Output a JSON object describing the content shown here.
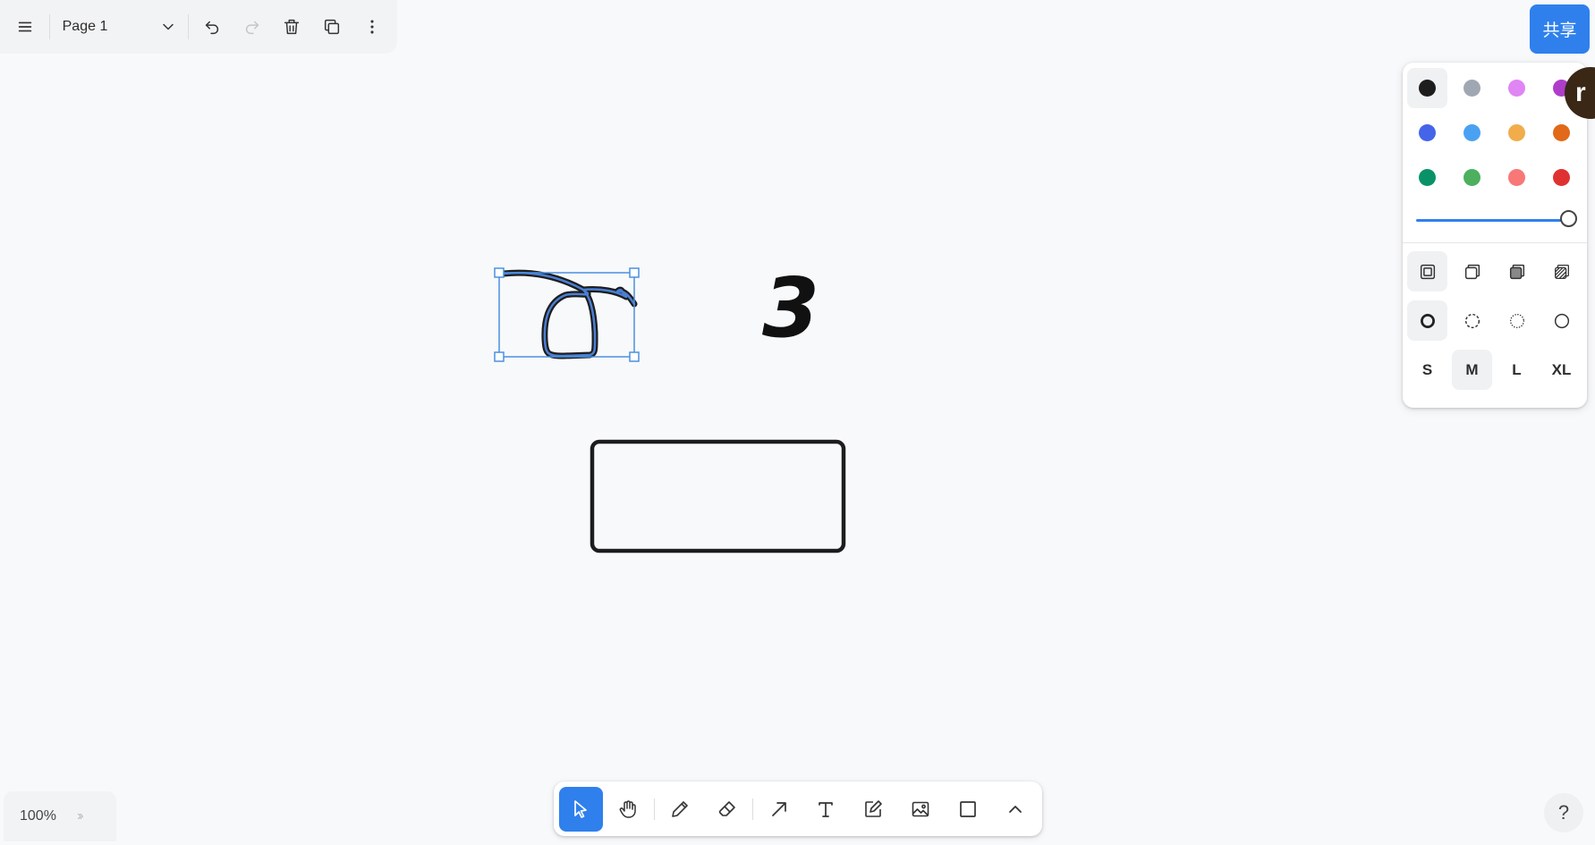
{
  "menu": {
    "page_name": "Page 1",
    "icons": [
      "menu-icon",
      "chevron-down-icon",
      "undo-icon",
      "redo-icon",
      "trash-icon",
      "duplicate-icon",
      "more-icon"
    ]
  },
  "share": {
    "label": "共享"
  },
  "avatar": {
    "initial": "r",
    "color": "#3a2716"
  },
  "style_panel": {
    "colors": [
      {
        "name": "black",
        "hex": "#1d1d1d",
        "selected": true
      },
      {
        "name": "grey",
        "hex": "#9fa8b2",
        "selected": false
      },
      {
        "name": "light-violet",
        "hex": "#e085f4",
        "selected": false
      },
      {
        "name": "violet",
        "hex": "#ae3ec9",
        "selected": false
      },
      {
        "name": "blue",
        "hex": "#4465e9",
        "selected": false
      },
      {
        "name": "light-blue",
        "hex": "#4ba1f1",
        "selected": false
      },
      {
        "name": "yellow",
        "hex": "#f1ac4b",
        "selected": false
      },
      {
        "name": "orange",
        "hex": "#e16919",
        "selected": false
      },
      {
        "name": "green",
        "hex": "#099268",
        "selected": false
      },
      {
        "name": "light-green",
        "hex": "#4cb05e",
        "selected": false
      },
      {
        "name": "light-red",
        "hex": "#f87777",
        "selected": false
      },
      {
        "name": "red",
        "hex": "#e03131",
        "selected": false
      }
    ],
    "opacity": 1,
    "fill_options": [
      {
        "name": "fill-none-icon",
        "selected": true
      },
      {
        "name": "fill-semi-icon",
        "selected": false
      },
      {
        "name": "fill-solid-icon",
        "selected": false
      },
      {
        "name": "fill-pattern-icon",
        "selected": false
      }
    ],
    "dash_options": [
      {
        "name": "dash-draw-icon",
        "selected": true
      },
      {
        "name": "dash-dashed-icon",
        "selected": false
      },
      {
        "name": "dash-dotted-icon",
        "selected": false
      },
      {
        "name": "dash-solid-icon",
        "selected": false
      }
    ],
    "sizes": [
      {
        "label": "S",
        "selected": false
      },
      {
        "label": "M",
        "selected": true
      },
      {
        "label": "L",
        "selected": false
      },
      {
        "label": "XL",
        "selected": false
      }
    ]
  },
  "canvas": {
    "text_shape": "3",
    "selection_color": "#4a90e2",
    "stroke_color": "#1d1d1d"
  },
  "zoom": {
    "level": "100%"
  },
  "toolbar": {
    "tools": [
      {
        "name": "select-tool",
        "icon": "cursor-icon",
        "active": true
      },
      {
        "name": "hand-tool",
        "icon": "hand-icon",
        "active": false
      },
      {
        "name": "draw-tool",
        "icon": "pencil-icon",
        "active": false
      },
      {
        "name": "eraser-tool",
        "icon": "eraser-icon",
        "active": false
      },
      {
        "name": "arrow-tool",
        "icon": "arrow-icon",
        "active": false
      },
      {
        "name": "text-tool",
        "icon": "text-icon",
        "active": false
      },
      {
        "name": "note-tool",
        "icon": "note-icon",
        "active": false
      },
      {
        "name": "image-tool",
        "icon": "image-icon",
        "active": false
      },
      {
        "name": "rectangle-tool",
        "icon": "rectangle-icon",
        "active": false
      },
      {
        "name": "more-tools",
        "icon": "chevron-up-icon",
        "active": false
      }
    ]
  },
  "help": {
    "label": "?"
  }
}
